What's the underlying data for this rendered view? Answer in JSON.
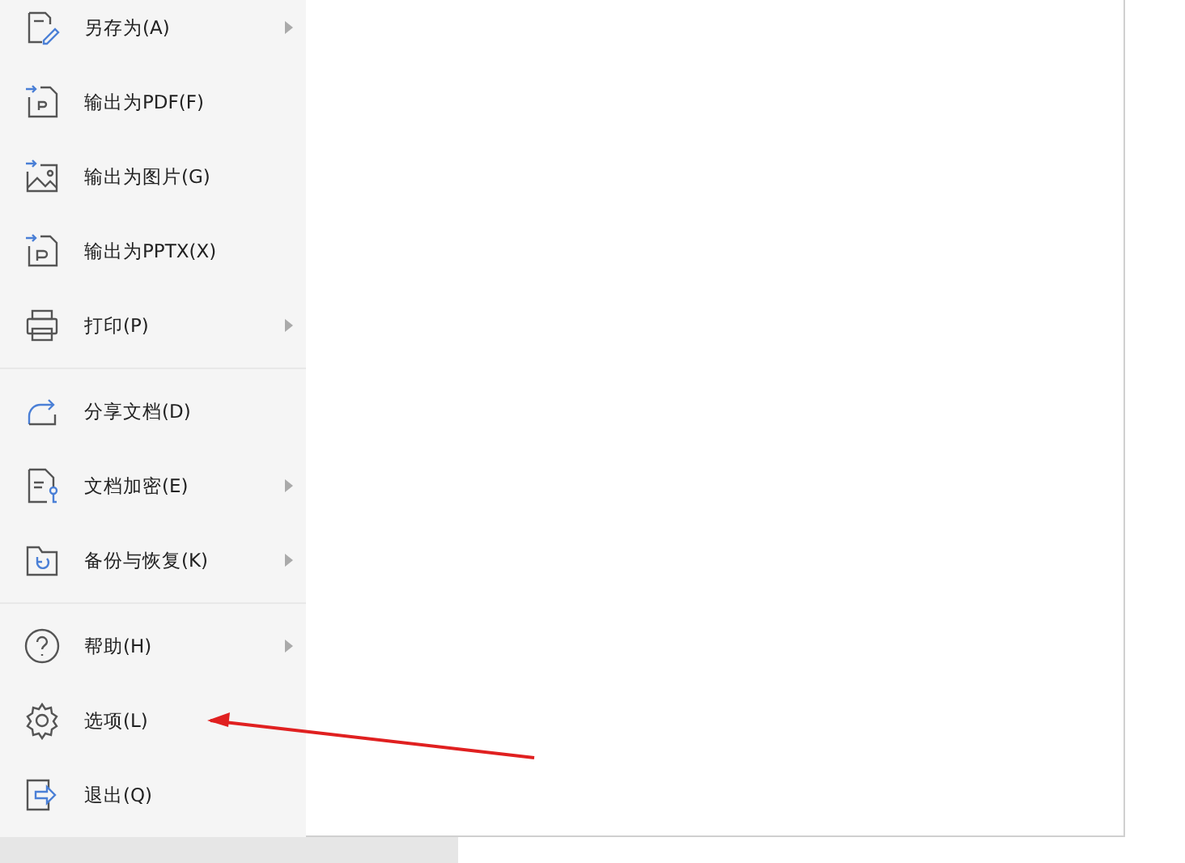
{
  "menu": {
    "groups": [
      {
        "items": [
          {
            "label": "另存为(A)",
            "has_submenu": true
          },
          {
            "label": "输出为PDF(F)",
            "has_submenu": false
          },
          {
            "label": "输出为图片(G)",
            "has_submenu": false
          },
          {
            "label": "输出为PPTX(X)",
            "has_submenu": false
          },
          {
            "label": "打印(P)",
            "has_submenu": true
          }
        ]
      },
      {
        "items": [
          {
            "label": "分享文档(D)",
            "has_submenu": false
          },
          {
            "label": "文档加密(E)",
            "has_submenu": true
          },
          {
            "label": "备份与恢复(K)",
            "has_submenu": true
          }
        ]
      },
      {
        "items": [
          {
            "label": "帮助(H)",
            "has_submenu": true
          },
          {
            "label": "选项(L)",
            "has_submenu": false
          },
          {
            "label": "退出(Q)",
            "has_submenu": false
          }
        ]
      }
    ]
  }
}
